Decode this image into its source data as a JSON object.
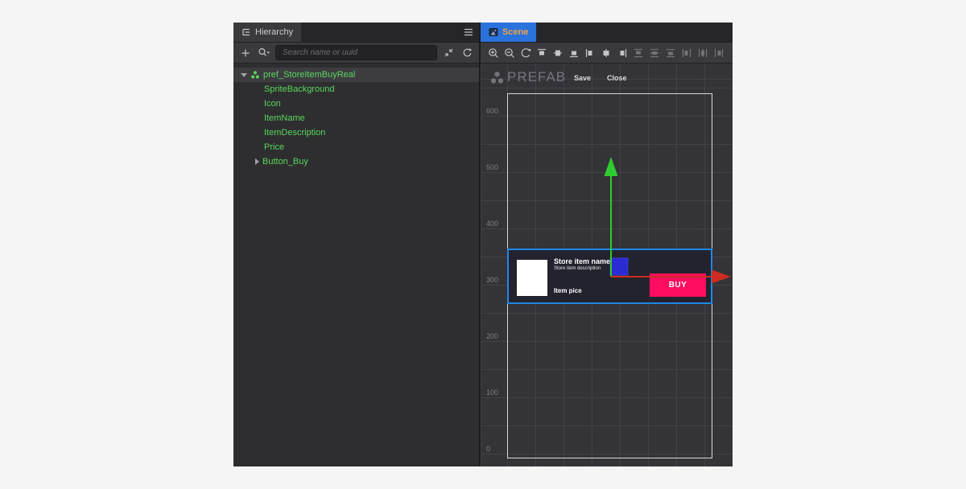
{
  "hierarchy": {
    "tab_label": "Hierarchy",
    "toolbar": {
      "add_label": "+",
      "search_placeholder": "Search name or uuid",
      "icons": [
        "add-icon",
        "search-filter-icon",
        "collapse-all-icon",
        "refresh-icon"
      ]
    },
    "menu_icon": "hamburger-menu-icon",
    "tree": {
      "root_label": "pref_StoreItemBuyReal",
      "root_icon": "prefab-icon",
      "children": [
        "SpriteBackground",
        "Icon",
        "ItemName",
        "ItemDescription",
        "Price",
        "Button_Buy"
      ]
    }
  },
  "scene": {
    "tab_label": "Scene",
    "tab_icon": "image-icon",
    "toolbar_icons": [
      "zoom-in-icon",
      "zoom-out-icon",
      "reset-view-icon",
      "align-top-icon",
      "align-vertical-center-icon",
      "align-bottom-icon",
      "align-left-icon",
      "align-horizontal-center-icon",
      "align-right-icon",
      "distribute-top-icon",
      "distribute-vertical-center-icon",
      "distribute-bottom-icon",
      "distribute-left-icon",
      "distribute-horizontal-center-icon",
      "distribute-right-icon"
    ],
    "header": {
      "badge": "PREFAB",
      "badge_icon": "prefab-icon",
      "save_label": "Save",
      "close_label": "Close"
    },
    "ruler_labels": [
      "600",
      "500",
      "400",
      "300",
      "200",
      "100",
      "0"
    ],
    "prefab_item": {
      "name": "Store item name",
      "description": "Store item description",
      "price": "Item pice",
      "buy_label": "BUY"
    },
    "colors": {
      "scene_tab_bg": "#2a72dc",
      "scene_tab_text": "#f0a14b",
      "prefab_text_green": "#58d65c",
      "selection_blue": "#1e88e5",
      "buy_button_pink": "#ff0d60",
      "axis_x_red": "#cc2d20",
      "axis_y_green": "#2ecc2e",
      "move_handle_blue": "#2b2bd4",
      "item_background": "#23232e",
      "frame_white": "#d9d9d9"
    }
  }
}
